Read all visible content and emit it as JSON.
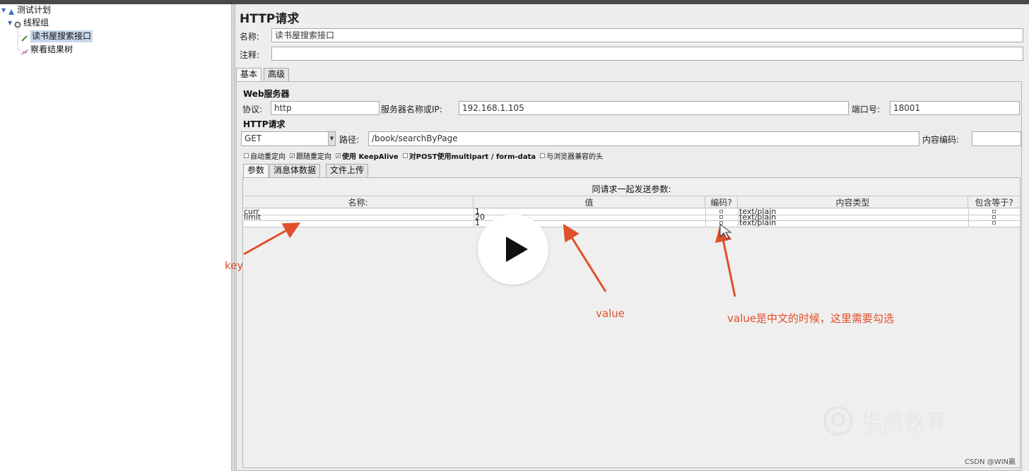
{
  "tree": {
    "root": "测试计划",
    "group": "线程组",
    "selected": "读书屋搜索接口",
    "listener": "察看结果树"
  },
  "form": {
    "title": "HTTP请求",
    "name_label": "名称:",
    "name_value": "读书屋搜索接口",
    "comment_label": "注释:",
    "comment_value": "",
    "tabs": [
      "基本",
      "高级"
    ],
    "web_server_header": "Web服务器",
    "protocol_label": "协议:",
    "protocol_value": "http",
    "server_label": "服务器名称或IP:",
    "server_value": "192.168.1.105",
    "port_label": "端口号:",
    "port_value": "18001",
    "http_header": "HTTP请求",
    "method_value": "GET",
    "path_label": "路径:",
    "path_value": "/book/searchByPage",
    "encoding_label": "内容编码:",
    "encoding_value": "",
    "options": [
      "自动重定向",
      "跟随重定向",
      "使用 KeepAlive",
      "对POST使用multipart / form-data",
      "与浏览器兼容的头"
    ],
    "subtabs": [
      "参数",
      "消息体数据",
      "文件上传"
    ],
    "params_caption": "同请求一起发送参数:",
    "columns": [
      "名称:",
      "值",
      "编码?",
      "内容类型",
      "包含等于?"
    ],
    "rows": [
      {
        "name": "curr",
        "value": "1",
        "type": "text/plain"
      },
      {
        "name": "limit",
        "value": "20",
        "type": "text/plain"
      },
      {
        "name": "",
        "value": "1",
        "type": "text/plain"
      }
    ]
  },
  "annotations": {
    "key": "key",
    "value": "value",
    "encode_note": "value是中文的时候，这里需要勾选"
  },
  "watermark": {
    "logo_cn": "华测教育",
    "logo_en": "HCTESTEDU",
    "credit": "CSDN @WIN赢"
  },
  "colors": {
    "annotation": "#e0502a",
    "selection": "#c8d8ec"
  }
}
